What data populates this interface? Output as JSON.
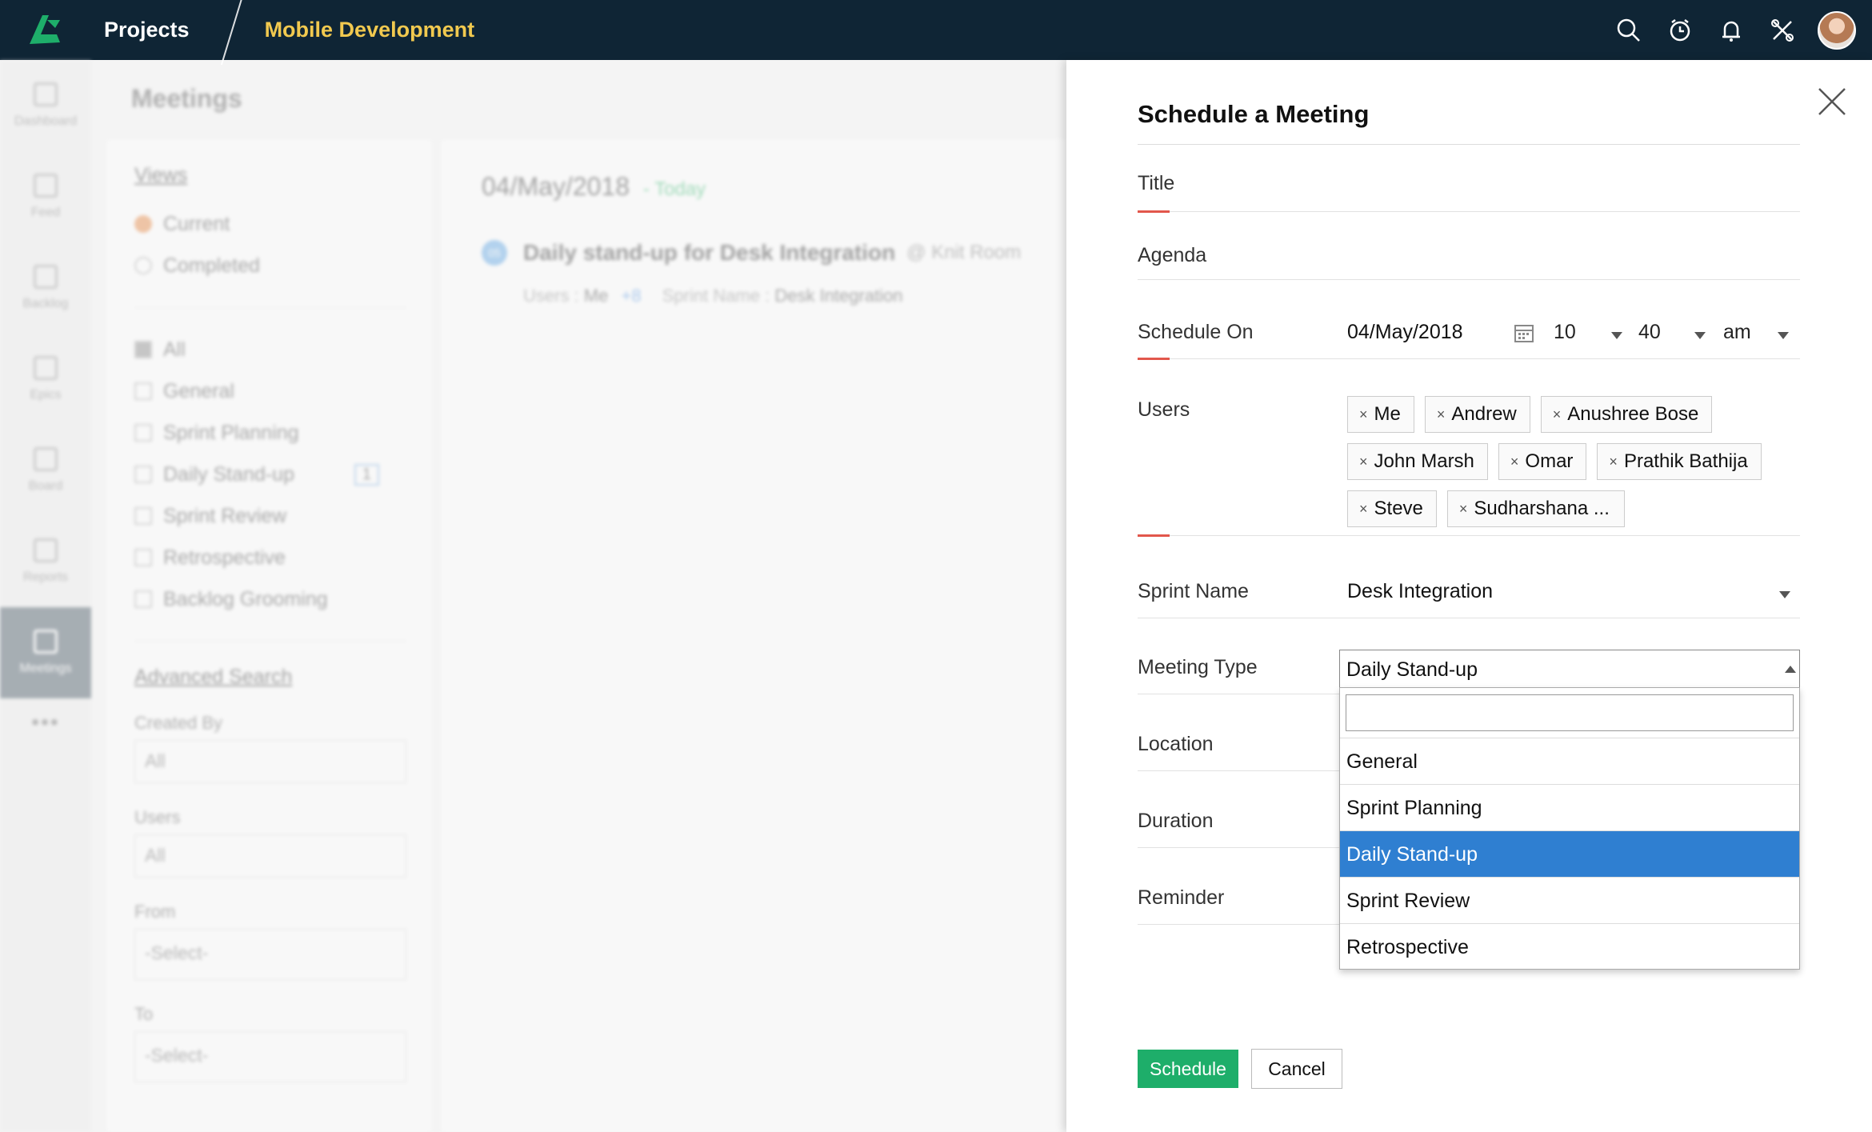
{
  "header": {
    "projects_label": "Projects",
    "project_name": "Mobile Development"
  },
  "leftnav": {
    "items": [
      {
        "label": "Dashboard",
        "icon": "dashboard-icon"
      },
      {
        "label": "Feed",
        "icon": "feed-icon"
      },
      {
        "label": "Backlog",
        "icon": "backlog-icon"
      },
      {
        "label": "Epics",
        "icon": "epics-icon"
      },
      {
        "label": "Board",
        "icon": "board-icon"
      },
      {
        "label": "Reports",
        "icon": "reports-icon"
      },
      {
        "label": "Meetings",
        "icon": "meetings-icon",
        "active": true
      }
    ],
    "more": "•••"
  },
  "background": {
    "page_title": "Meetings",
    "views_label": "Views",
    "views": [
      "Current",
      "Completed"
    ],
    "types": [
      "All",
      "General",
      "Sprint Planning",
      "Daily Stand-up",
      "Sprint Review",
      "Retrospective",
      "Backlog Grooming"
    ],
    "daily_standup_count": "1",
    "advanced_search": "Advanced Search",
    "created_by_label": "Created By",
    "created_by_value": "All",
    "users_label": "Users",
    "users_value": "All",
    "from_label": "From",
    "from_value": "-Select-",
    "to_label": "To",
    "to_value": "-Select-",
    "date": "04/May/2018",
    "today": "- Today",
    "meeting_badge": "05",
    "meeting_title": "Daily stand-up for Desk Integration",
    "meeting_location": "@ Knit Room",
    "meeting_users_label": "Users :",
    "meeting_users_value": "Me",
    "meeting_users_more": "+8",
    "meeting_sprint_label": "Sprint Name :",
    "meeting_sprint_value": "Desk Integration"
  },
  "form": {
    "title": "Schedule a Meeting",
    "title_label": "Title",
    "agenda_label": "Agenda",
    "schedule_on_label": "Schedule On",
    "schedule_date": "04/May/2018",
    "schedule_hour": "10",
    "schedule_minute": "40",
    "schedule_ampm": "am",
    "users_label": "Users",
    "users": [
      "Me",
      "Andrew",
      "Anushree Bose",
      "John Marsh",
      "Omar",
      "Prathik Bathija",
      "Steve",
      "Sudharshana ..."
    ],
    "chip_remove": "×",
    "sprint_name_label": "Sprint Name",
    "sprint_name_value": "Desk Integration",
    "meeting_type_label": "Meeting Type",
    "meeting_type_value": "Daily Stand-up",
    "meeting_type_options": [
      "General",
      "Sprint Planning",
      "Daily Stand-up",
      "Sprint Review",
      "Retrospective"
    ],
    "meeting_type_selected_index": 2,
    "location_label": "Location",
    "duration_label": "Duration",
    "reminder_label": "Reminder",
    "schedule_button": "Schedule",
    "cancel_button": "Cancel"
  },
  "colors": {
    "topbar": "#0f2535",
    "project_name": "#f1c94f",
    "accent_red": "#e2574c",
    "selected_blue": "#2f7fd1",
    "schedule_green": "#1eae6a",
    "today_green": "#2eb86a"
  }
}
